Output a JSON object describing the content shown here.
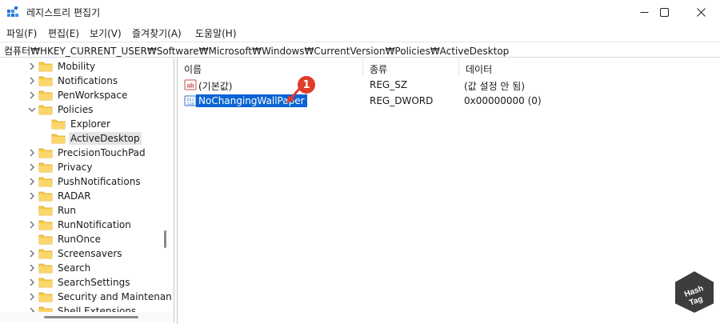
{
  "window": {
    "title": "레지스트리 편집기",
    "controls": [
      "minimize",
      "maximize",
      "close"
    ]
  },
  "menu": {
    "items": [
      "파일(F)",
      "편집(E)",
      "보기(V)",
      "즐겨찾기(A)",
      "도움말(H)"
    ]
  },
  "address": {
    "path": "컴퓨터₩HKEY_CURRENT_USER₩Software₩Microsoft₩Windows₩CurrentVersion₩Policies₩ActiveDesktop"
  },
  "tree": {
    "items": [
      {
        "label": "Mobility",
        "expander": "collapsed"
      },
      {
        "label": "Notifications",
        "expander": "collapsed"
      },
      {
        "label": "PenWorkspace",
        "expander": "collapsed"
      },
      {
        "label": "Policies",
        "expander": "expanded"
      },
      {
        "label": "Explorer",
        "expander": "none",
        "child": true
      },
      {
        "label": "ActiveDesktop",
        "expander": "none",
        "child": true,
        "selected": true
      },
      {
        "label": "PrecisionTouchPad",
        "expander": "collapsed"
      },
      {
        "label": "Privacy",
        "expander": "collapsed"
      },
      {
        "label": "PushNotifications",
        "expander": "collapsed"
      },
      {
        "label": "RADAR",
        "expander": "collapsed"
      },
      {
        "label": "Run",
        "expander": "none"
      },
      {
        "label": "RunNotification",
        "expander": "collapsed"
      },
      {
        "label": "RunOnce",
        "expander": "none"
      },
      {
        "label": "Screensavers",
        "expander": "collapsed"
      },
      {
        "label": "Search",
        "expander": "collapsed"
      },
      {
        "label": "SearchSettings",
        "expander": "collapsed"
      },
      {
        "label": "Security and Maintenan",
        "expander": "collapsed"
      },
      {
        "label": "Shell Extensions",
        "expander": "collapsed"
      }
    ]
  },
  "list": {
    "columns": [
      "이름",
      "종류",
      "데이터"
    ],
    "rows": [
      {
        "name": "(기본값)",
        "type": "REG_SZ",
        "data": "(값 설정 안 됨)",
        "icon": "string-value-icon"
      },
      {
        "name": "NoChangingWallPaper",
        "type": "REG_DWORD",
        "data": "0x00000000 (0)",
        "icon": "binary-value-icon",
        "selected": true
      }
    ]
  },
  "annotation": {
    "badge_number": "1"
  },
  "colors": {
    "selection_blue": "#0a64d2",
    "folder_yellow": "#f7c948",
    "badge_red": "#e03c2c"
  }
}
